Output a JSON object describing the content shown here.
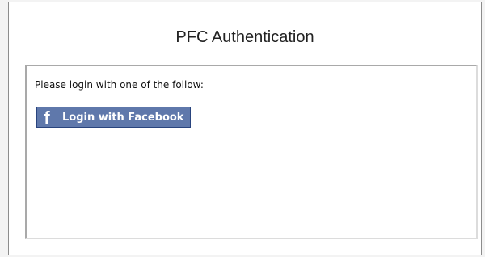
{
  "title": "PFC Authentication",
  "panel": {
    "prompt": "Please login with one of the follow:",
    "facebook_button": {
      "icon_glyph": "f",
      "label": "Login with Facebook"
    }
  },
  "colors": {
    "facebook_blue": "#5f78ab",
    "facebook_border": "#29447e"
  }
}
